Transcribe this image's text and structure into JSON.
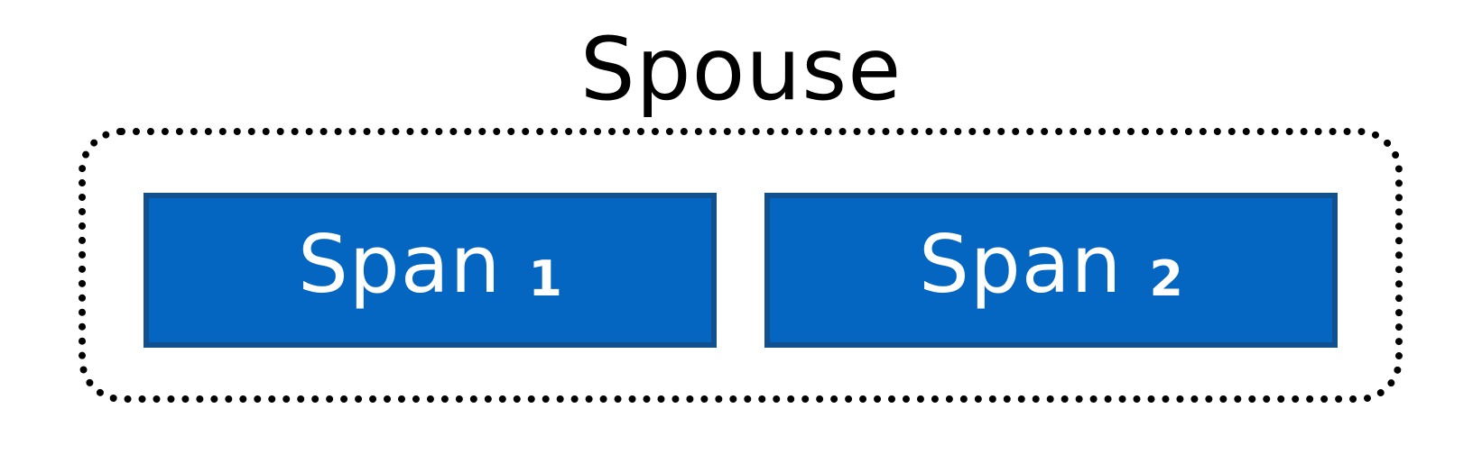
{
  "diagram": {
    "title": "Spouse",
    "spans": [
      {
        "word": "Span",
        "number": "1"
      },
      {
        "word": "Span",
        "number": "2"
      }
    ]
  },
  "colors": {
    "span_fill": "#0566c2",
    "span_border": "#10508f",
    "span_text": "#ffffff",
    "group_border": "#000000"
  }
}
